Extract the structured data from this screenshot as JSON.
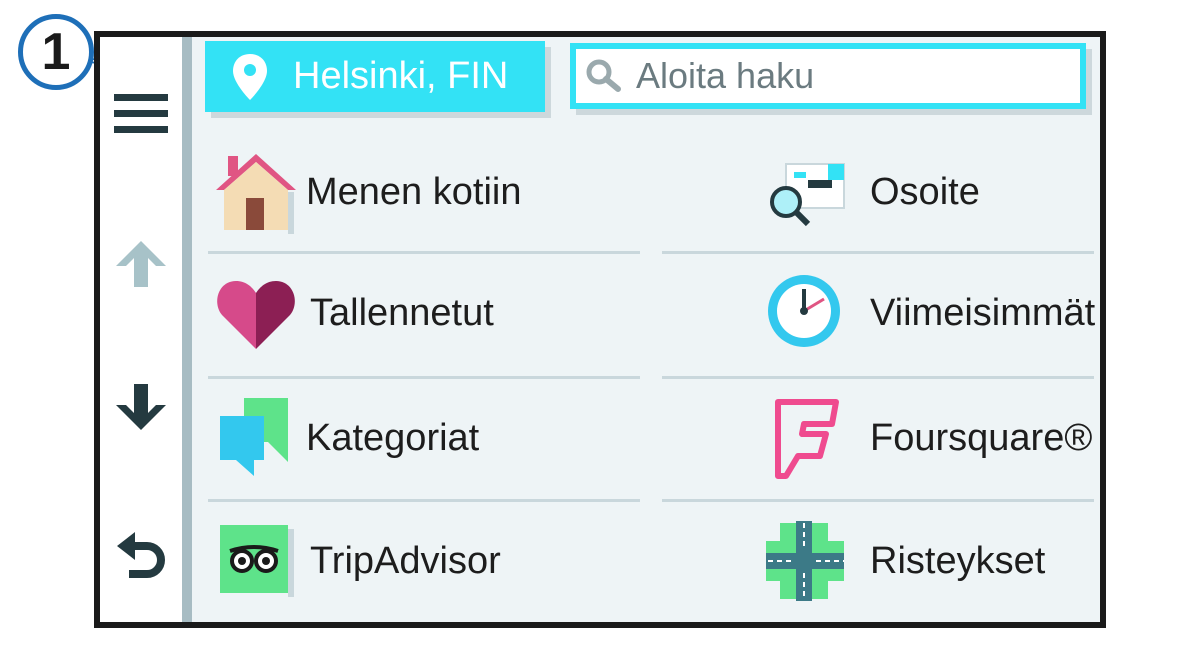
{
  "location_button": {
    "label": "Helsinki, FIN",
    "icon": "map-pin-icon"
  },
  "search": {
    "placeholder": "Aloita haku",
    "icon": "search-icon"
  },
  "sidebar": {
    "buttons": [
      {
        "name": "menu",
        "icon": "hamburger-menu-icon"
      },
      {
        "name": "scroll-up",
        "icon": "arrow-up-icon"
      },
      {
        "name": "scroll-down",
        "icon": "arrow-down-icon"
      },
      {
        "name": "back",
        "icon": "back-arrow-icon"
      }
    ]
  },
  "categories": [
    {
      "label": "Menen kotiin",
      "icon": "home-icon"
    },
    {
      "label": "Osoite",
      "icon": "address-search-icon"
    },
    {
      "label": "Tallennetut",
      "icon": "heart-icon"
    },
    {
      "label": "Viimeisimmät",
      "icon": "clock-icon"
    },
    {
      "label": "Kategoriat",
      "icon": "categories-icon"
    },
    {
      "label": "Foursquare®",
      "icon": "foursquare-icon"
    },
    {
      "label": "TripAdvisor",
      "icon": "tripadvisor-icon"
    },
    {
      "label": "Risteykset",
      "icon": "intersection-icon"
    }
  ],
  "callout": {
    "number": "1"
  },
  "colors": {
    "accent": "#33e2f5",
    "callout": "#1e6fb8",
    "panel": "#eef4f6",
    "sidebar_rule": "#a7bcc3"
  }
}
